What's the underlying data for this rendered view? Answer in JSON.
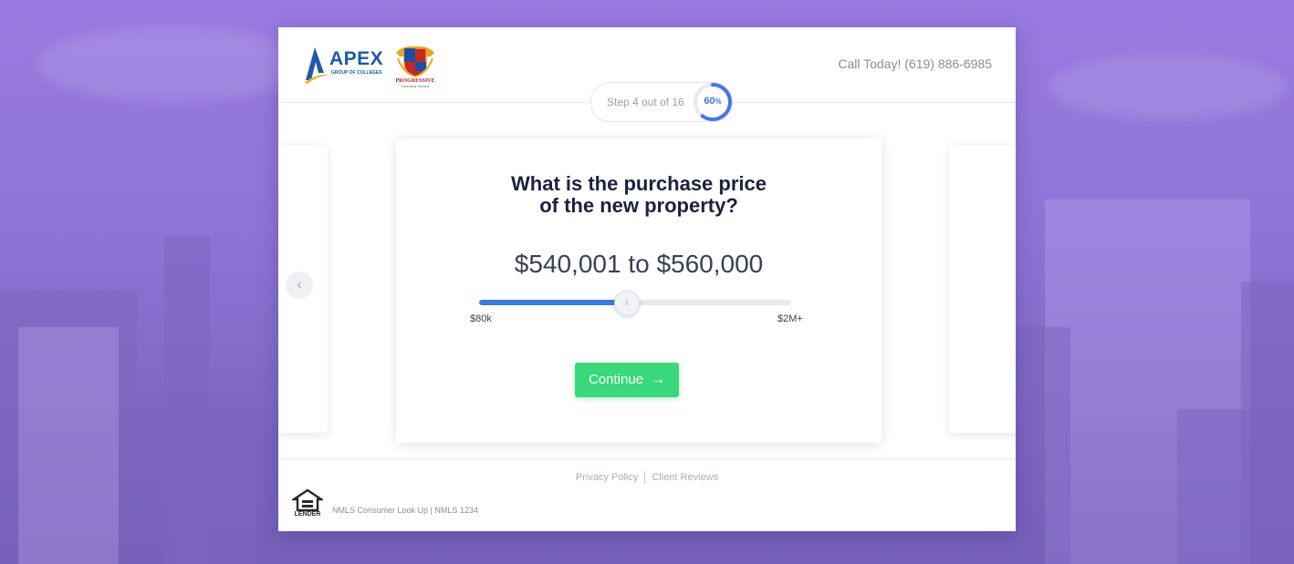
{
  "header": {
    "apex_logo_text": "APEX",
    "apex_logo_subtext": "GROUP OF COLLEGES",
    "partner_logo_text": "PROGRESSIVE",
    "partner_logo_subtext": "Grammar School",
    "call_text": "Call Today! (619) 886-6985"
  },
  "progress": {
    "step_text": "Step 4 out of 16",
    "percent": "60",
    "percent_symbol": "%",
    "value": 0.6
  },
  "navigation": {
    "prev_icon": "chevron-left-icon"
  },
  "question": {
    "title_line1": "What is the purchase price",
    "title_line2": "of the new property?",
    "price_range": "$540,001 to $560,000",
    "slider_min_label": "$80k",
    "slider_max_label": "$2M+",
    "slider_value": 0.47,
    "continue_label": "Continue",
    "continue_icon": "arrow-right-icon"
  },
  "footer": {
    "privacy_link": "Privacy Policy",
    "reviews_link": "Client Reviews",
    "equal_housing_text": "LENDER",
    "nmls_text": "NMLS Consumer Look Up | NMLS 1234"
  },
  "colors": {
    "accent_blue": "#3d7ae0",
    "continue_green": "#39d87a",
    "background_purple": "#8f74d6"
  }
}
